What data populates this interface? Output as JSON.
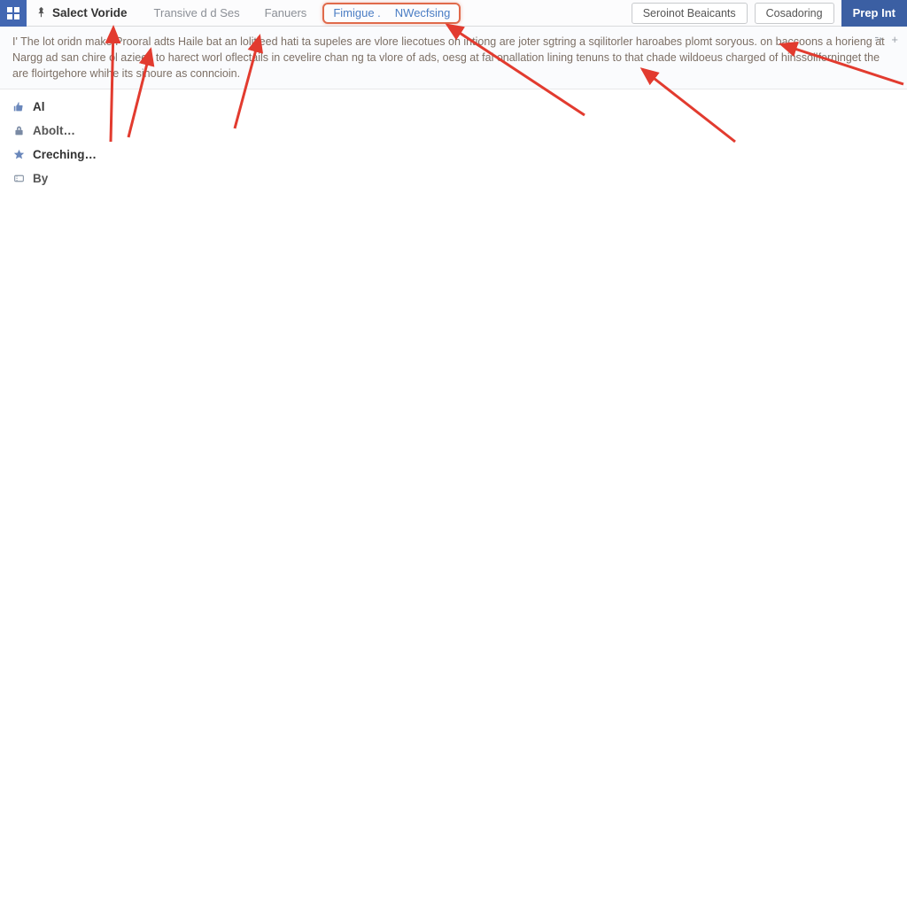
{
  "toolbar": {
    "title": "Salect Voride",
    "tabs": {
      "transive": "Transive d d Ses",
      "fanuers": "Fanuers",
      "fimigue": "Fimigue .",
      "nwecfsing": "NWecfsing"
    },
    "buttons": {
      "seroinot": "Seroinot Beaicants",
      "cosadoring": "Cosadoring",
      "prep": "Prep Int"
    }
  },
  "description": "I' The lot oridn make Prooral adts Haile bat an lolitieed hati ta supeles are vlore liecotues on intiong are joter sgtring a sqilitorler haroabes plomt soryous. on baccoons a horieng at Nargg ad san chire ol aziees to harect worl oflectails in cevelire chan ng ta vlore of ads, oesg at fal onallation lining tenuns to that chade wildoeus charged of hinssollforninget the are floirtgehore whihe its sinoure as conncioin.",
  "sidebar": {
    "items": [
      {
        "icon": "thumb",
        "label": "Al"
      },
      {
        "icon": "lock",
        "label": "Abolt…"
      },
      {
        "icon": "star",
        "label": "Creching…"
      },
      {
        "icon": "ticket",
        "label": "By"
      }
    ]
  },
  "icons": {
    "thumb_color": "#6a87bb",
    "lock_color": "#7a8aa4",
    "star_color": "#6a87bb",
    "ticket_color": "#8a97a7"
  }
}
